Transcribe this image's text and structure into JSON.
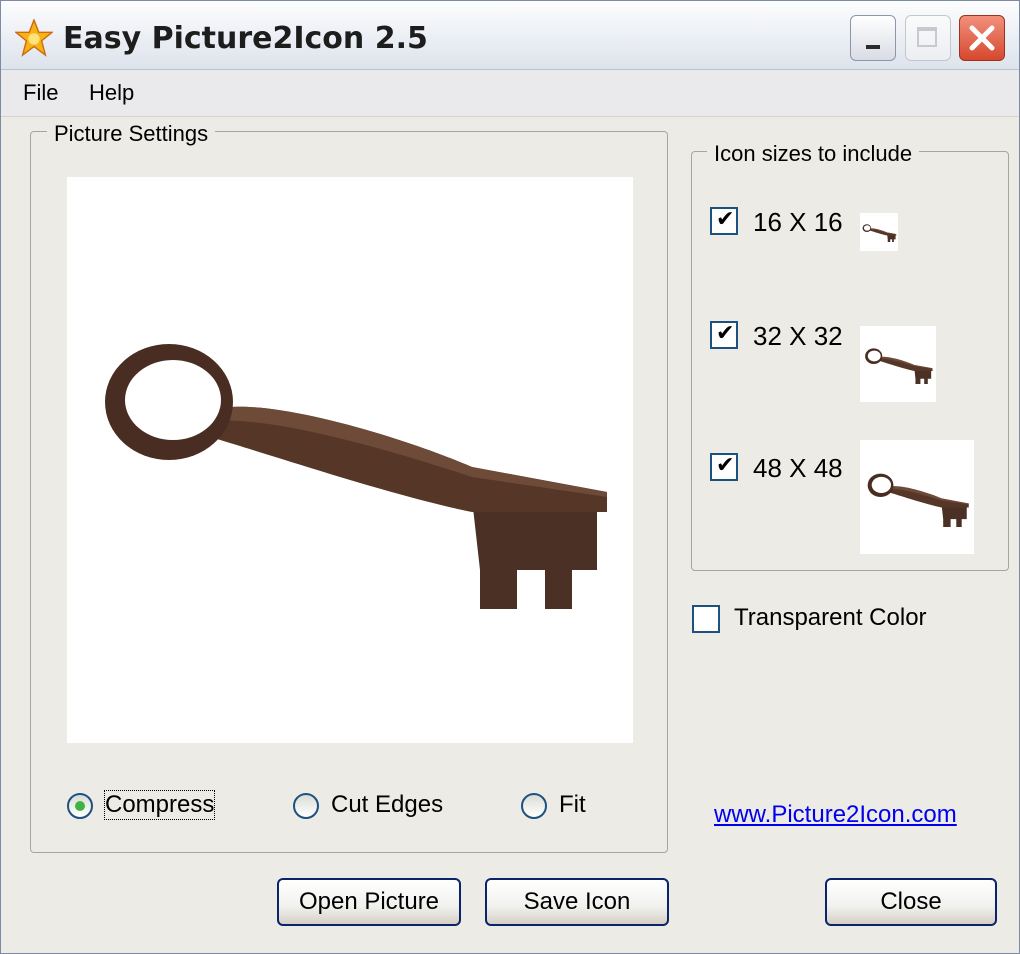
{
  "window": {
    "title": "Easy Picture2Icon 2.5"
  },
  "menu": {
    "items": [
      "File",
      "Help"
    ]
  },
  "picture_settings": {
    "legend": "Picture Settings",
    "modes": [
      {
        "label": "Compress",
        "selected": true
      },
      {
        "label": "Cut Edges",
        "selected": false
      },
      {
        "label": "Fit",
        "selected": false
      }
    ]
  },
  "icon_sizes": {
    "legend": "Icon sizes to include",
    "sizes": [
      {
        "label": "16 X 16",
        "checked": true
      },
      {
        "label": "32 X 32",
        "checked": true
      },
      {
        "label": "48 X 48",
        "checked": true
      }
    ]
  },
  "transparent_color": {
    "label": "Transparent Color",
    "checked": false
  },
  "link": {
    "text": "www.Picture2Icon.com"
  },
  "buttons": {
    "open": "Open Picture",
    "save": "Save Icon",
    "close": "Close"
  },
  "colors": {
    "accent": "#0a246a",
    "link": "#0000ee",
    "key": "#4a2f22"
  }
}
